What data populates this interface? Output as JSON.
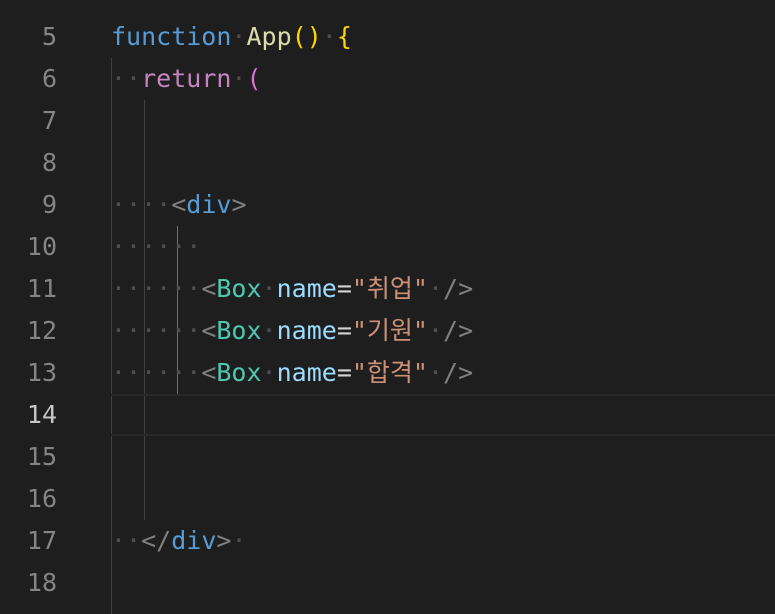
{
  "editor": {
    "active_line": "14",
    "colors": {
      "background": "#1e1e1e",
      "line_number": "#858585",
      "active_line_number": "#c6c6c6"
    },
    "lines": [
      {
        "number": "5",
        "tokens": {
          "kw": "function",
          "fn": "App",
          "parens": "()",
          "brace": "{"
        }
      },
      {
        "number": "6",
        "tokens": {
          "kw": "return",
          "paren": "("
        }
      },
      {
        "number": "7"
      },
      {
        "number": "8"
      },
      {
        "number": "9",
        "tokens": {
          "open": "<",
          "tag": "div",
          "close": ">"
        }
      },
      {
        "number": "10"
      },
      {
        "number": "11",
        "tokens": {
          "open": "<",
          "component": "Box",
          "attr": "name",
          "eq": "=",
          "value": "\"취업\"",
          "selfclose": "/>"
        }
      },
      {
        "number": "12",
        "tokens": {
          "open": "<",
          "component": "Box",
          "attr": "name",
          "eq": "=",
          "value": "\"기원\"",
          "selfclose": "/>"
        }
      },
      {
        "number": "13",
        "tokens": {
          "open": "<",
          "component": "Box",
          "attr": "name",
          "eq": "=",
          "value": "\"합격\"",
          "selfclose": "/>"
        }
      },
      {
        "number": "14"
      },
      {
        "number": "15"
      },
      {
        "number": "16"
      },
      {
        "number": "17",
        "tokens": {
          "open": "</",
          "tag": "div",
          "close": ">"
        }
      },
      {
        "number": "18"
      }
    ]
  }
}
